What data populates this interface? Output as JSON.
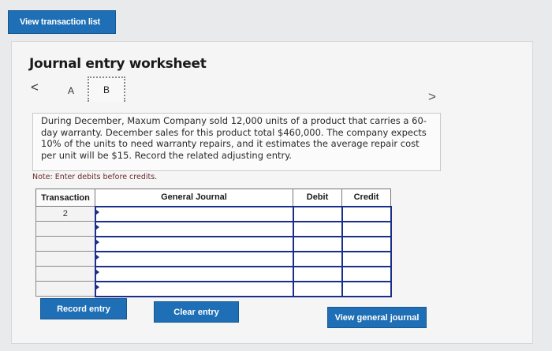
{
  "top_button": {
    "label": "View transaction list"
  },
  "worksheet": {
    "title": "Journal entry worksheet",
    "nav_prev": "<",
    "nav_next": ">",
    "tabs": [
      {
        "label": "A"
      },
      {
        "label": "B"
      }
    ],
    "active_tab": "B",
    "problem_text": "During December, Maxum Company sold 12,000 units of a product that carries a 60-day warranty. December sales for this product total $460,000. The company expects 10% of the units to need warranty repairs, and it estimates the average repair cost per unit will be $15. Record the related adjusting entry.",
    "note": "Note: Enter debits before credits."
  },
  "table": {
    "headers": {
      "transaction": "Transaction",
      "general_journal": "General Journal",
      "debit": "Debit",
      "credit": "Credit"
    },
    "transaction_number": "2",
    "rows": [
      {
        "journal": "",
        "debit": "",
        "credit": ""
      },
      {
        "journal": "",
        "debit": "",
        "credit": ""
      },
      {
        "journal": "",
        "debit": "",
        "credit": ""
      },
      {
        "journal": "",
        "debit": "",
        "credit": ""
      },
      {
        "journal": "",
        "debit": "",
        "credit": ""
      },
      {
        "journal": "",
        "debit": "",
        "credit": ""
      }
    ]
  },
  "buttons": {
    "record": "Record entry",
    "clear": "Clear entry",
    "view_general": "View general journal"
  },
  "colors": {
    "button_blue": "#1e6fb5",
    "input_border": "#1a2e8a"
  }
}
